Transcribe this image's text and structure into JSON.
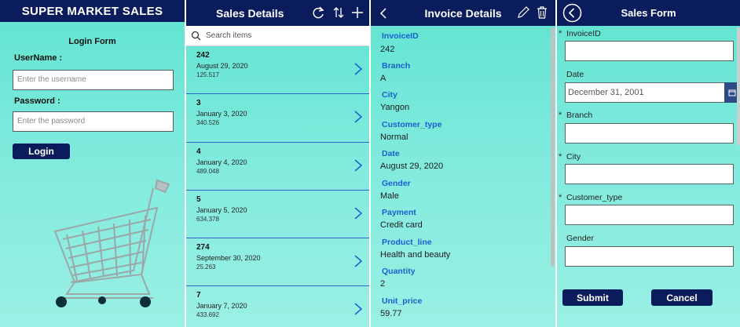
{
  "login": {
    "app_title": "SUPER MARKET SALES",
    "form_title": "Login Form",
    "username_label": "UserName :",
    "username_placeholder": "Enter the username",
    "password_label": "Password :",
    "password_placeholder": "Enter the password",
    "login_button": "Login"
  },
  "sales": {
    "title": "Sales Details",
    "search_placeholder": "Search items",
    "items": [
      {
        "id": "242",
        "date": "August 29, 2020",
        "amount": "125.517"
      },
      {
        "id": "3",
        "date": "January 3, 2020",
        "amount": "340.526"
      },
      {
        "id": "4",
        "date": "January 4, 2020",
        "amount": "489.048"
      },
      {
        "id": "5",
        "date": "January 5, 2020",
        "amount": "634.378"
      },
      {
        "id": "274",
        "date": "September 30, 2020",
        "amount": "25.263"
      },
      {
        "id": "7",
        "date": "January 7, 2020",
        "amount": "433.692"
      }
    ]
  },
  "invoice": {
    "title": "Invoice Details",
    "fields": [
      {
        "label": "InvoiceID",
        "value": "242"
      },
      {
        "label": "Branch",
        "value": "A"
      },
      {
        "label": "City",
        "value": "Yangon"
      },
      {
        "label": "Customer_type",
        "value": "Normal"
      },
      {
        "label": "Date",
        "value": "August 29, 2020"
      },
      {
        "label": "Gender",
        "value": "Male"
      },
      {
        "label": "Payment",
        "value": "Credit card"
      },
      {
        "label": "Product_line",
        "value": "Health and beauty"
      },
      {
        "label": "Quantity",
        "value": "2"
      },
      {
        "label": "Unit_price",
        "value": "59.77"
      }
    ]
  },
  "form": {
    "title": "Sales Form",
    "invoice_label": "InvoiceID",
    "date_label": "Date",
    "date_value": "December 31, 2001",
    "branch_label": "Branch",
    "city_label": "City",
    "customer_type_label": "Customer_type",
    "gender_label": "Gender",
    "required_mark": "*",
    "submit_button": "Submit",
    "cancel_button": "Cancel"
  },
  "colors": {
    "header": "#0b1c5c",
    "accent_label": "#1a5fd0",
    "background": "#6fe6d6",
    "row_divider": "#2d63c8"
  }
}
